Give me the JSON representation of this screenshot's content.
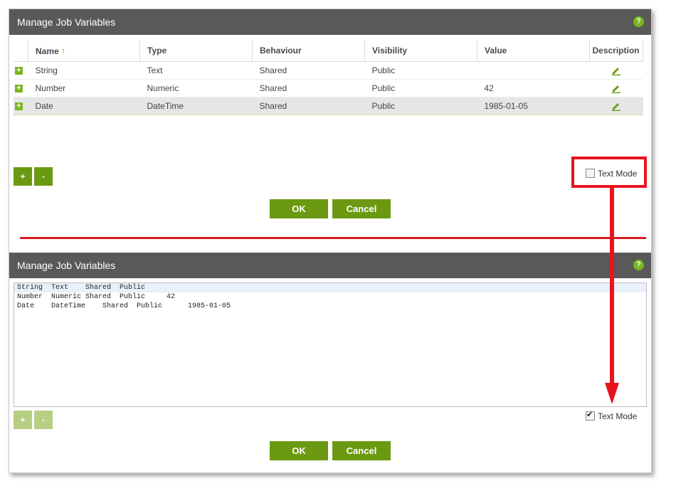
{
  "top_dialog": {
    "title": "Manage Job Variables",
    "help_icon": "?",
    "columns": [
      "Name",
      "Type",
      "Behaviour",
      "Visibility",
      "Value",
      "Description"
    ],
    "sort_indicator": "↑",
    "rows": [
      {
        "name": "String",
        "type": "Text",
        "behaviour": "Shared",
        "visibility": "Public",
        "value": ""
      },
      {
        "name": "Number",
        "type": "Numeric",
        "behaviour": "Shared",
        "visibility": "Public",
        "value": "42"
      },
      {
        "name": "Date",
        "type": "DateTime",
        "behaviour": "Shared",
        "visibility": "Public",
        "value": "1985-01-05"
      }
    ],
    "add_button": "+",
    "remove_button": "-",
    "text_mode_label": "Text Mode",
    "text_mode_checked": false,
    "ok_label": "OK",
    "cancel_label": "Cancel"
  },
  "bottom_dialog": {
    "title": "Manage Job Variables",
    "help_icon": "?",
    "text_lines": [
      "String  Text    Shared  Public",
      "Number  Numeric Shared  Public     42",
      "Date    DateTime    Shared  Public      1985-01-05"
    ],
    "add_button": "+",
    "remove_button": "-",
    "text_mode_label": "Text Mode",
    "text_mode_checked": true,
    "ok_label": "OK",
    "cancel_label": "Cancel"
  },
  "colors": {
    "accent_green": "#6b9a12",
    "titlebar": "#595959",
    "annotation_red": "#e8141c"
  },
  "icons": {
    "expand": "plus-box-icon",
    "edit": "pencil-icon",
    "help": "help-circle-icon"
  }
}
